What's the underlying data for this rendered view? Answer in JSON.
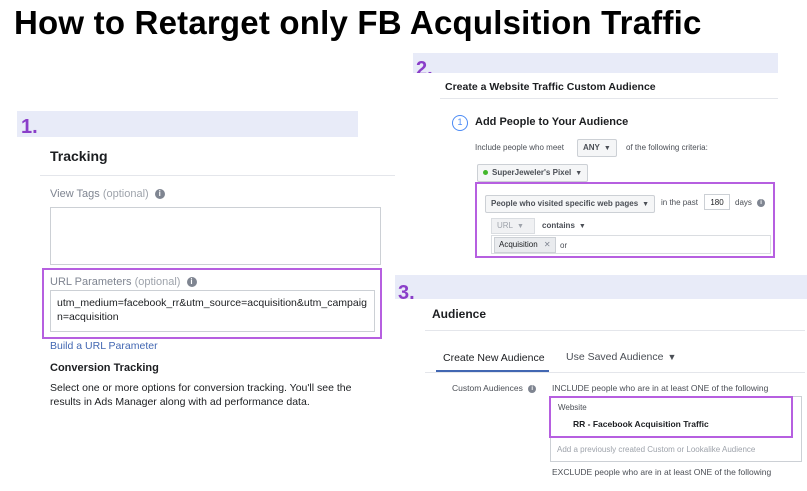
{
  "title": "How to Retarget only FB Acqulsition Traffic",
  "panel1": {
    "number": "1.",
    "heading": "Tracking",
    "view_tags_label": "View Tags",
    "view_tags_optional": "(optional)",
    "url_params_label": "URL Parameters",
    "url_params_optional": "(optional)",
    "url_params_value": "utm_medium=facebook_rr&utm_source=acquisition&utm_campaign=acquisition",
    "build_link": "Build a URL Parameter",
    "conversion_heading": "Conversion Tracking",
    "conversion_desc": "Select one or more options for conversion tracking. You'll see the results in Ads Manager along with ad performance data."
  },
  "panel2": {
    "number": "2.",
    "heading": "Create a Website Traffic Custom Audience",
    "step_number": "1",
    "step_title": "Add People to Your Audience",
    "include_text": "Include people who meet",
    "any_value": "ANY",
    "criteria_text": "of the following criteria:",
    "pixel_name": "SuperJeweler's Pixel",
    "rule_select": "People who visited specific web pages",
    "in_past": "in the past",
    "days_value": "180",
    "days_label": "days",
    "url_label": "URL",
    "contains_label": "contains",
    "chip_value": "Acquisition",
    "or_label": "or"
  },
  "panel3": {
    "number": "3.",
    "heading": "Audience",
    "tab_create": "Create New Audience",
    "tab_saved": "Use Saved Audience",
    "custom_audiences_label": "Custom Audiences",
    "include_text": "INCLUDE people who are in at least ONE of the following",
    "website_caption": "Website",
    "audience_name": "RR - Facebook Acquisition Traffic",
    "add_placeholder": "Add a previously created Custom or Lookalike Audience",
    "exclude_text": "EXCLUDE people who are in at least ONE of the following"
  },
  "colors": {
    "highlight": "#b65fe0",
    "number": "#8a3ec9",
    "band": "#e8ebf8",
    "link": "#4267b2"
  }
}
